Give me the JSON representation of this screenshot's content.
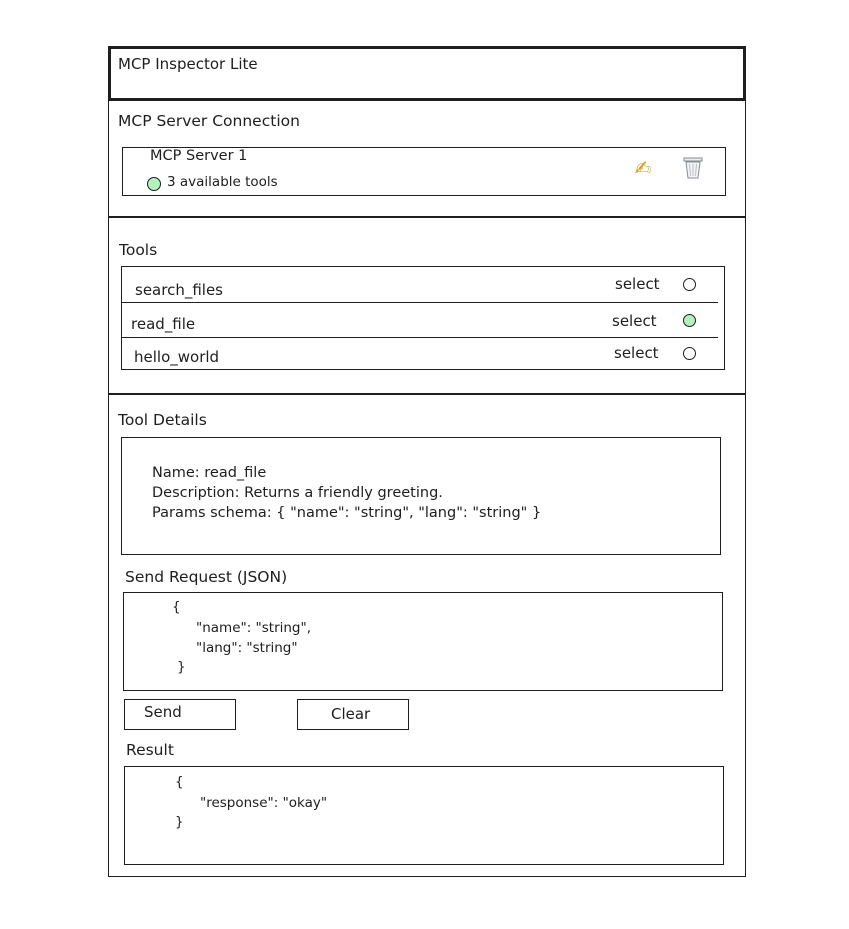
{
  "app": {
    "title": "MCP Inspector Lite"
  },
  "connection": {
    "section_title": "MCP Server Connection",
    "server": {
      "name": "MCP Server 1",
      "tools_count_text": "3 available tools",
      "status_color": "#b2f2bb",
      "edit_icon": "pencil-icon",
      "delete_icon": "trash-icon"
    }
  },
  "tools": {
    "section_title": "Tools",
    "select_label": "select",
    "items": [
      {
        "name": "search_files",
        "selected": false
      },
      {
        "name": "read_file",
        "selected": true
      },
      {
        "name": "hello_world",
        "selected": false
      }
    ]
  },
  "details": {
    "section_title": "Tool Details",
    "lines": [
      "Name: read_file",
      "Description: Returns a friendly greeting.",
      "Params schema: { \"name\": \"string\", \"lang\": \"string\" }"
    ]
  },
  "request": {
    "section_title": "Send Request (JSON)",
    "lines": [
      "{",
      "\"name\": \"string\",",
      "\"lang\": \"string\"",
      "}"
    ]
  },
  "actions": {
    "send_label": "Send",
    "clear_label": "Clear"
  },
  "result": {
    "section_title": "Result",
    "lines": [
      "{",
      "\"response\": \"okay\"",
      "}"
    ]
  },
  "colors": {
    "accent_green": "#b2f2bb",
    "stroke": "#1e1e1e",
    "edit_icon": "#d39a1a"
  }
}
